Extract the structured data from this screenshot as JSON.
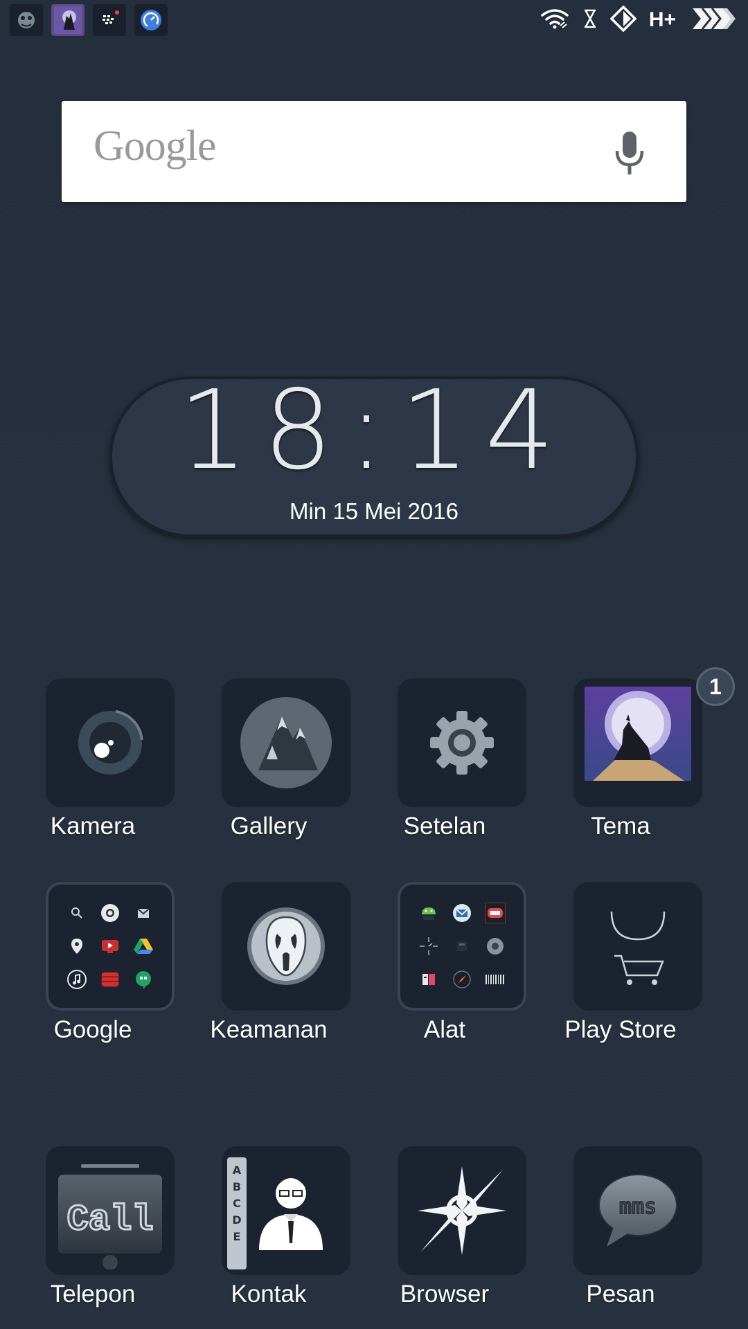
{
  "status_bar": {
    "notifications": [
      "game-icon",
      "wolf-theme-icon",
      "bbm-icon",
      "speedometer-icon"
    ],
    "network_type": "H+"
  },
  "search": {
    "logo": "Google",
    "voice_icon": "mic-icon"
  },
  "clock": {
    "time": "18:14",
    "date": "Min 15 Mei 2016"
  },
  "apps": {
    "kamera": "Kamera",
    "gallery": "Gallery",
    "setelan": "Setelan",
    "tema": "Tema",
    "tema_badge": "1",
    "google": "Google",
    "keamanan": "Keamanan",
    "alat": "Alat",
    "play_store": "Play Store",
    "telepon": "Telepon",
    "kontak": "Kontak",
    "browser": "Browser",
    "pesan": "Pesan"
  },
  "icon_text": {
    "call": "Call",
    "mms": "mms",
    "letters": [
      "A",
      "B",
      "C",
      "D",
      "E"
    ]
  }
}
